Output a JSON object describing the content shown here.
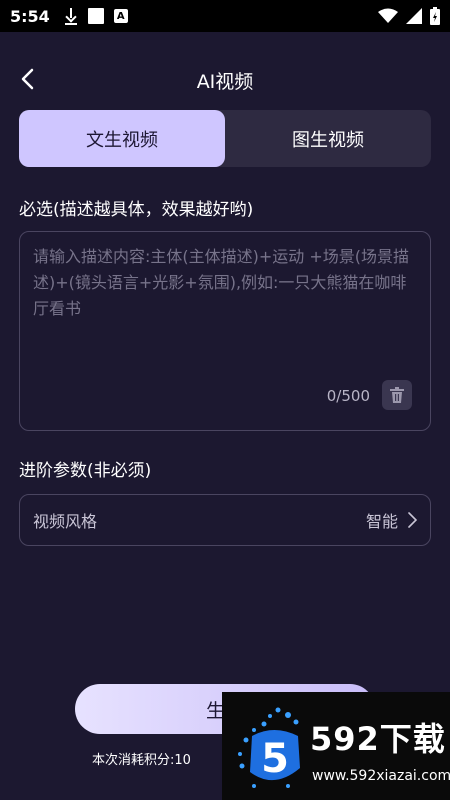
{
  "status_bar": {
    "time": "5:54",
    "a_badge": "A"
  },
  "header": {
    "title": "AI视频"
  },
  "tabs": [
    {
      "label": "文生视频",
      "active": true
    },
    {
      "label": "图生视频",
      "active": false
    }
  ],
  "required": {
    "label": "必选(描述越具体，效果越好哟)",
    "placeholder": "请输入描述内容:主体(主体描述)+运动 +场景(场景描述)+(镜头语言+光影+氛围),例如:一只大熊猫在咖啡厅看书",
    "counter": "0/500"
  },
  "advanced": {
    "label": "进阶参数(非必须)",
    "style_label": "视频风格",
    "style_value": "智能"
  },
  "generate": {
    "label": "生成",
    "cost_label": "本次消耗积分:",
    "cost_value": "10"
  },
  "watermark": {
    "brand": "592下载",
    "url": "www.592xiazai.com",
    "logo_digit": "5"
  },
  "colors": {
    "background": "#1c1830",
    "accent": "#cfc6ff",
    "tab_bg": "#2e2a41",
    "border": "#4a4560"
  }
}
